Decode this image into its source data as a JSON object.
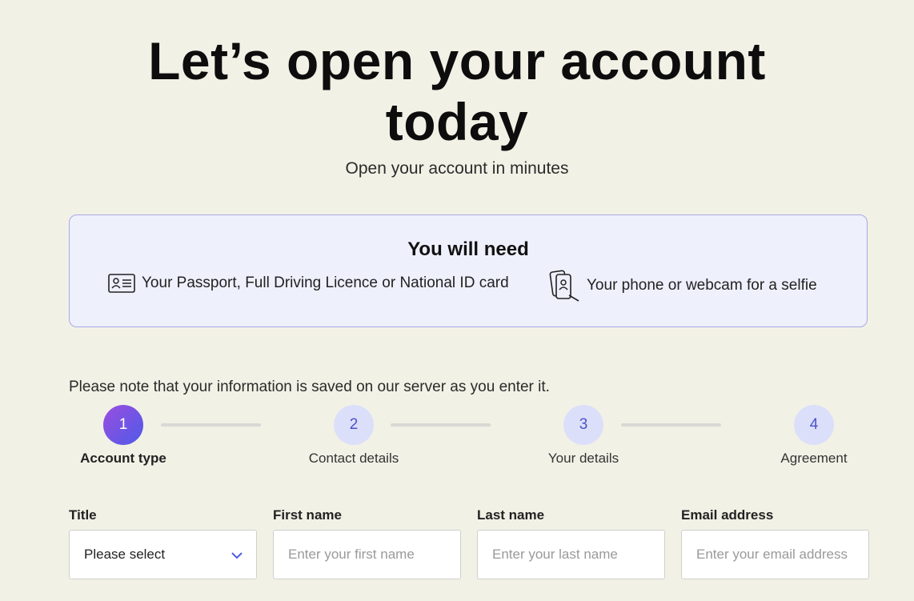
{
  "hero": {
    "title_line1": "Let’s open your account",
    "title_line2": "today",
    "subtitle": "Open your account in minutes"
  },
  "need": {
    "title": "You will need",
    "items": [
      {
        "icon": "id-card-icon",
        "text": "Your Passport, Full Driving Licence or National ID card"
      },
      {
        "icon": "phone-selfie-icon",
        "text": "Your phone or webcam for a selfie"
      }
    ]
  },
  "note": "Please note that your information is saved on our server as you enter it.",
  "steps": [
    {
      "number": "1",
      "label": "Account type",
      "active": true
    },
    {
      "number": "2",
      "label": "Contact details",
      "active": false
    },
    {
      "number": "3",
      "label": "Your details",
      "active": false
    },
    {
      "number": "4",
      "label": "Agreement",
      "active": false
    }
  ],
  "form": {
    "title": {
      "label": "Title",
      "value": "Please select"
    },
    "first_name": {
      "label": "First name",
      "placeholder": "Enter your first name"
    },
    "last_name": {
      "label": "Last name",
      "placeholder": "Enter your last name"
    },
    "email": {
      "label": "Email address",
      "placeholder": "Enter your email address"
    }
  },
  "colors": {
    "background": "#f2f1e6",
    "accent": "#4e5be8",
    "box_bg": "#eef0fc",
    "box_border": "#a9a9e4"
  }
}
